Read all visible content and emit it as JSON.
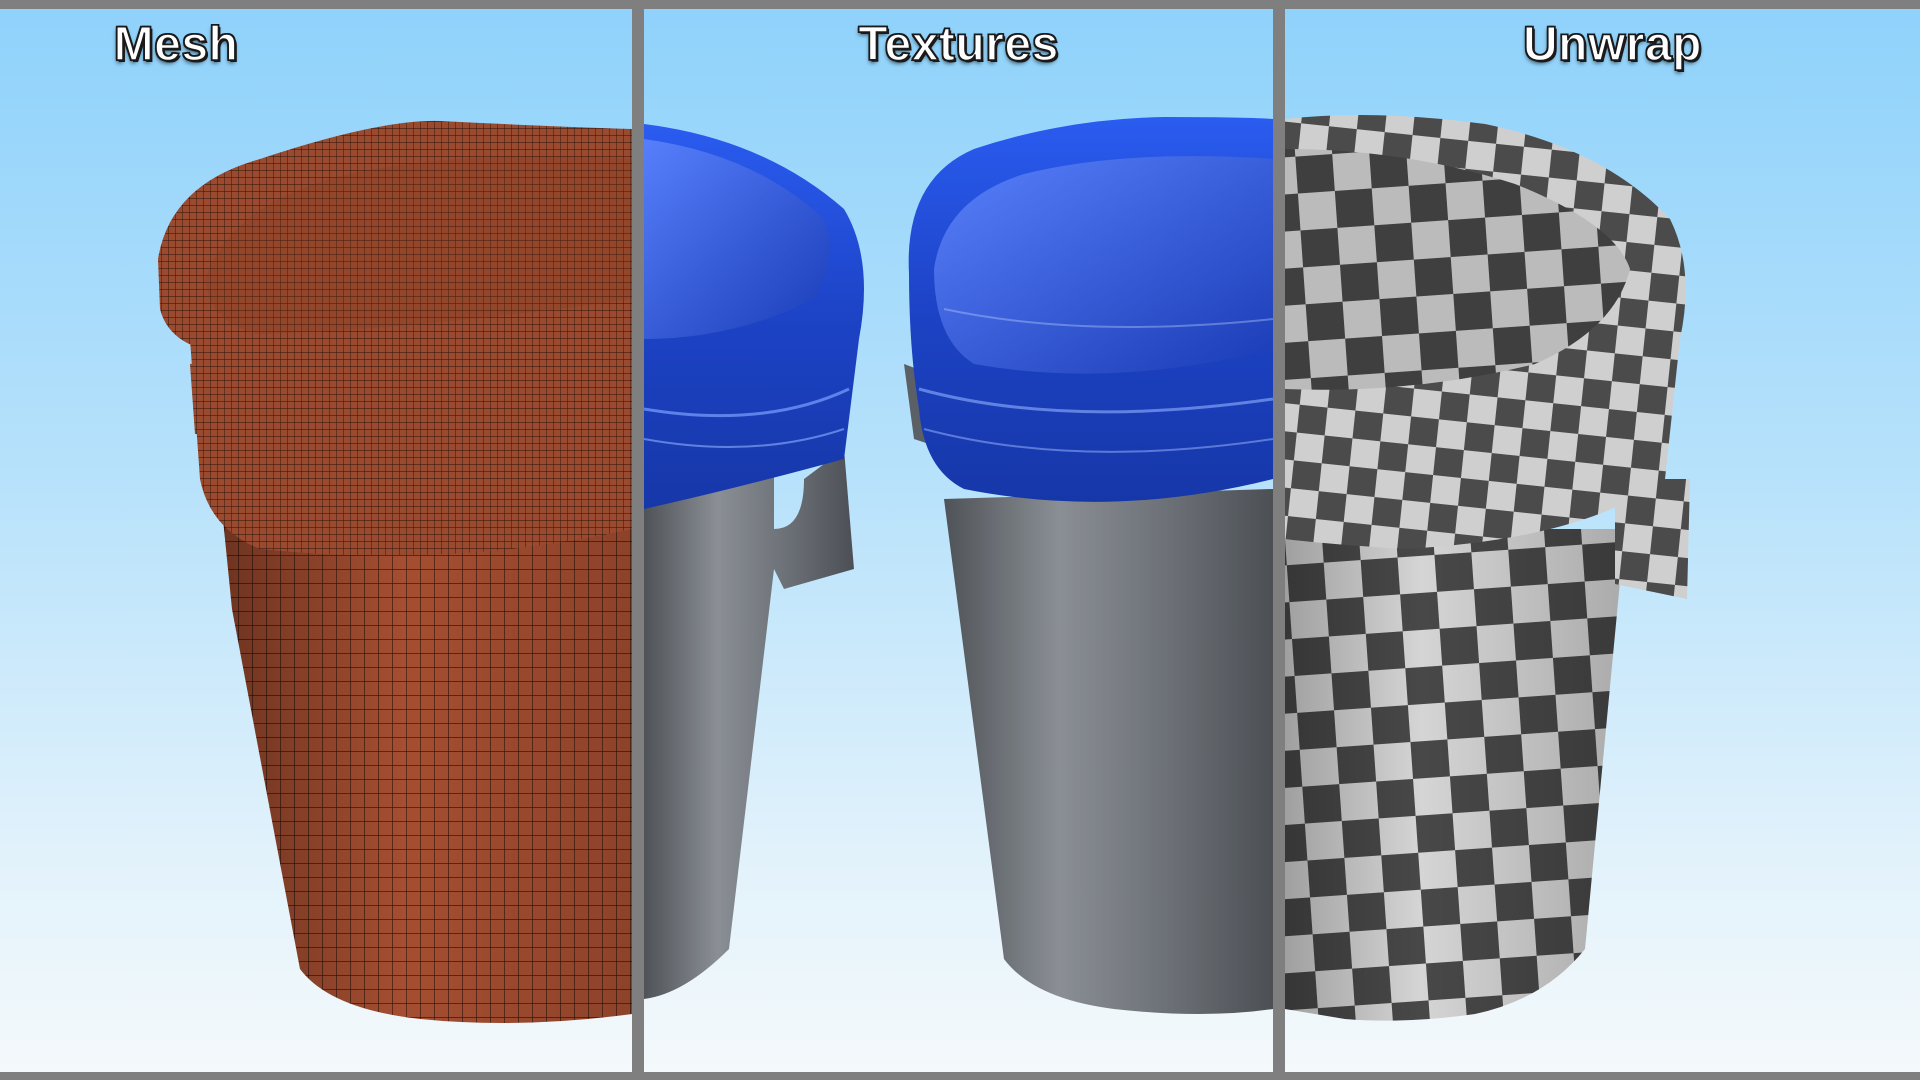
{
  "panels": [
    {
      "id": "mesh",
      "title": "Mesh"
    },
    {
      "id": "textures",
      "title": "Textures"
    },
    {
      "id": "unwrap",
      "title": "Unwrap"
    }
  ],
  "colors": {
    "frame": "#7f7f7f",
    "sky_top": "#8fd2fb",
    "sky_bottom": "#f4f9fb",
    "mesh_base": "#a84f32",
    "mesh_wire": "#2a1208",
    "bag_blue": "#1f4fd8",
    "bin_gray": "#6e737a",
    "checker_dark": "#4a4a4a",
    "checker_light": "#d4d4d4"
  }
}
